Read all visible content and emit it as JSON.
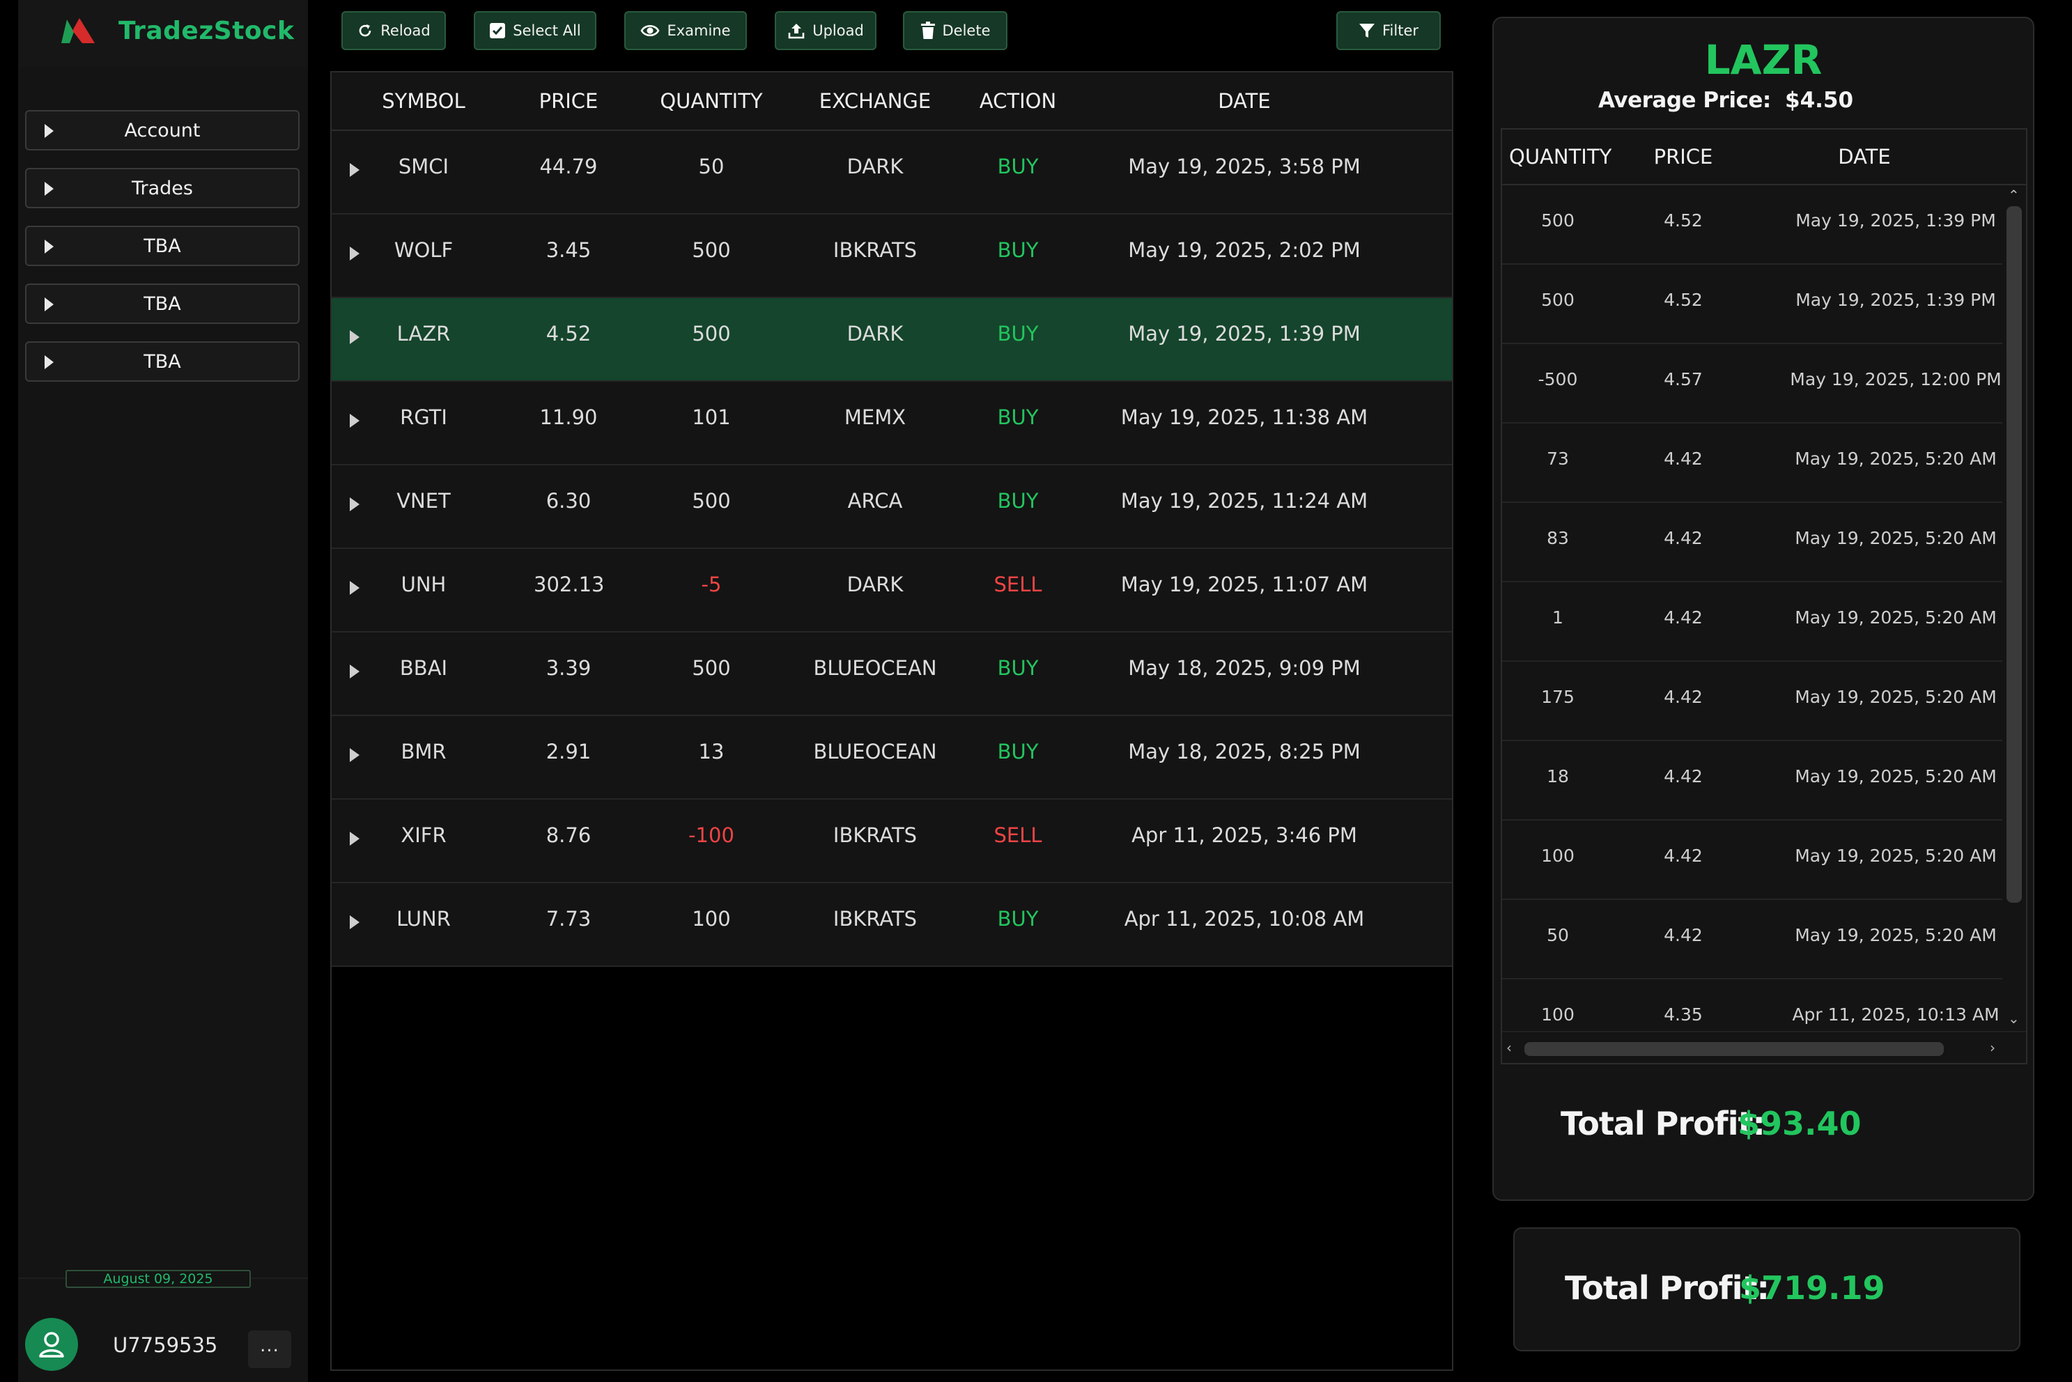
{
  "app": {
    "name": "TradezStock",
    "logo_icon": "brand-logo-icon"
  },
  "sidebar": {
    "items": [
      {
        "label": "Account",
        "icon": "caret-right-icon"
      },
      {
        "label": "Trades",
        "icon": "caret-right-icon"
      },
      {
        "label": "TBA",
        "icon": "caret-right-icon"
      },
      {
        "label": "TBA",
        "icon": "caret-right-icon"
      },
      {
        "label": "TBA",
        "icon": "caret-right-icon"
      }
    ],
    "date": "August 09, 2025",
    "user": {
      "id": "U7759535",
      "avatar_icon": "user-icon",
      "more_label": "..."
    }
  },
  "toolbar": {
    "reload": "Reload",
    "select_all": "Select All",
    "examine": "Examine",
    "upload": "Upload",
    "delete": "Delete",
    "filter": "Filter"
  },
  "trades": {
    "headers": {
      "symbol": "SYMBOL",
      "price": "PRICE",
      "quantity": "QUANTITY",
      "exchange": "EXCHANGE",
      "action": "ACTION",
      "date": "DATE"
    },
    "rows": [
      {
        "symbol": "SMCI",
        "price": "44.79",
        "quantity": "50",
        "exchange": "DARK",
        "action": "BUY",
        "date": "May 19, 2025, 3:58 PM"
      },
      {
        "symbol": "WOLF",
        "price": "3.45",
        "quantity": "500",
        "exchange": "IBKRATS",
        "action": "BUY",
        "date": "May 19, 2025, 2:02 PM"
      },
      {
        "symbol": "LAZR",
        "price": "4.52",
        "quantity": "500",
        "exchange": "DARK",
        "action": "BUY",
        "date": "May 19, 2025, 1:39 PM"
      },
      {
        "symbol": "RGTI",
        "price": "11.90",
        "quantity": "101",
        "exchange": "MEMX",
        "action": "BUY",
        "date": "May 19, 2025, 11:38 AM"
      },
      {
        "symbol": "VNET",
        "price": "6.30",
        "quantity": "500",
        "exchange": "ARCA",
        "action": "BUY",
        "date": "May 19, 2025, 11:24 AM"
      },
      {
        "symbol": "UNH",
        "price": "302.13",
        "quantity": "-5",
        "exchange": "DARK",
        "action": "SELL",
        "date": "May 19, 2025, 11:07 AM"
      },
      {
        "symbol": "BBAI",
        "price": "3.39",
        "quantity": "500",
        "exchange": "BLUEOCEAN",
        "action": "BUY",
        "date": "May 18, 2025, 9:09 PM"
      },
      {
        "symbol": "BMR",
        "price": "2.91",
        "quantity": "13",
        "exchange": "BLUEOCEAN",
        "action": "BUY",
        "date": "May 18, 2025, 8:25 PM"
      },
      {
        "symbol": "XIFR",
        "price": "8.76",
        "quantity": "-100",
        "exchange": "IBKRATS",
        "action": "SELL",
        "date": "Apr 11, 2025, 3:46 PM"
      },
      {
        "symbol": "LUNR",
        "price": "7.73",
        "quantity": "100",
        "exchange": "IBKRATS",
        "action": "BUY",
        "date": "Apr 11, 2025, 10:08 AM"
      }
    ],
    "selected_symbol": "LAZR"
  },
  "detail": {
    "symbol": "LAZR",
    "avg_price_label": "Average Price:",
    "avg_price_value": "$4.50",
    "headers": {
      "quantity": "QUANTITY",
      "price": "PRICE",
      "date": "DATE"
    },
    "rows": [
      {
        "quantity": "500",
        "price": "4.52",
        "date": "May 19, 2025, 1:39 PM"
      },
      {
        "quantity": "500",
        "price": "4.52",
        "date": "May 19, 2025, 1:39 PM"
      },
      {
        "quantity": "-500",
        "price": "4.57",
        "date": "May 19, 2025, 12:00 PM"
      },
      {
        "quantity": "73",
        "price": "4.42",
        "date": "May 19, 2025, 5:20 AM"
      },
      {
        "quantity": "83",
        "price": "4.42",
        "date": "May 19, 2025, 5:20 AM"
      },
      {
        "quantity": "1",
        "price": "4.42",
        "date": "May 19, 2025, 5:20 AM"
      },
      {
        "quantity": "175",
        "price": "4.42",
        "date": "May 19, 2025, 5:20 AM"
      },
      {
        "quantity": "18",
        "price": "4.42",
        "date": "May 19, 2025, 5:20 AM"
      },
      {
        "quantity": "100",
        "price": "4.42",
        "date": "May 19, 2025, 5:20 AM"
      },
      {
        "quantity": "50",
        "price": "4.42",
        "date": "May 19, 2025, 5:20 AM"
      },
      {
        "quantity": "100",
        "price": "4.35",
        "date": "Apr 11, 2025, 10:13 AM"
      }
    ],
    "profit_label": "Total Profit:",
    "profit_value": "$93.40"
  },
  "total": {
    "label": "Total Profit:",
    "value": "$719.19"
  },
  "colors": {
    "accent": "#21b96a",
    "buy": "#22c55e",
    "sell": "#ef4444",
    "selected_row": "#15452c",
    "panel": "#141414"
  }
}
